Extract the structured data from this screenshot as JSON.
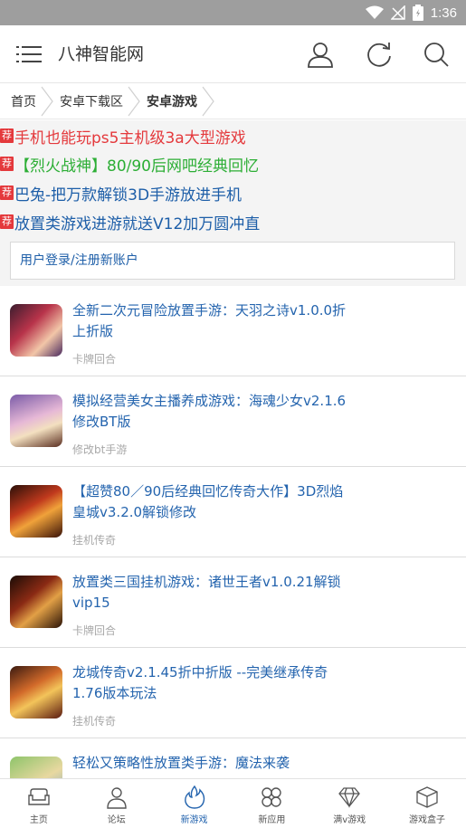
{
  "status": {
    "time": "1:36"
  },
  "header": {
    "title": "八神智能网",
    "icons": [
      "menu-icon",
      "user-icon",
      "refresh-icon",
      "search-icon"
    ]
  },
  "breadcrumb": [
    "首页",
    "安卓下载区",
    "安卓游戏"
  ],
  "promos": [
    {
      "tag": "荐",
      "text": "手机也能玩ps5主机级3a大型游戏",
      "color": "#e4393c"
    },
    {
      "tag": "荐",
      "text": "【烈火战神】80/90后网吧经典回忆",
      "color": "#2cae35"
    },
    {
      "tag": "荐",
      "text": "巴兔-把万款解锁3D手游放进手机",
      "color": "#1d5ea8"
    },
    {
      "tag": "荐",
      "text": "放置类游戏进游就送V12加万圆冲直",
      "color": "#1d5ea8"
    }
  ],
  "login_link": "用户登录/注册新账户",
  "games": [
    {
      "title": "全新二次元冒险放置手游：天羽之诗v1.0.0折上折版",
      "category": "卡牌回合"
    },
    {
      "title": "模拟经营美女主播养成游戏：海魂少女v2.1.6修改BT版",
      "category": "修改bt手游"
    },
    {
      "title": "【超赞80／90后经典回忆传奇大作】3D烈焰皇城v3.2.0解锁修改",
      "category": "挂机传奇"
    },
    {
      "title": "放置类三国挂机游戏：诸世王者v1.0.21解锁vip15",
      "category": "卡牌回合"
    },
    {
      "title": "龙城传奇v2.1.45折中折版 --完美继承传奇1.76版本玩法",
      "category": "挂机传奇"
    },
    {
      "title": "轻松又策略性放置类手游：魔法来袭",
      "category": ""
    }
  ],
  "tabs": [
    {
      "label": "主页",
      "icon": "sofa-icon"
    },
    {
      "label": "论坛",
      "icon": "person-icon"
    },
    {
      "label": "新游戏",
      "icon": "flame-icon"
    },
    {
      "label": "新应用",
      "icon": "grid-icon"
    },
    {
      "label": "满v游戏",
      "icon": "diamond-icon"
    },
    {
      "label": "游戏盒子",
      "icon": "box-icon"
    }
  ],
  "colors": {
    "accent": "#2464ae",
    "promo_red": "#e4393c",
    "status_bar": "#9e9e9e"
  }
}
